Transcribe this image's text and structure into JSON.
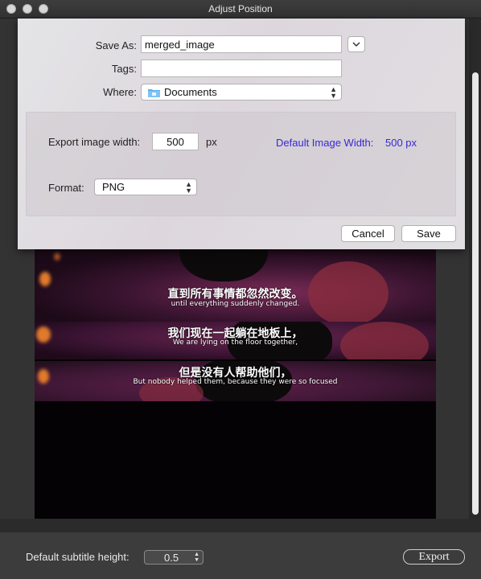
{
  "window": {
    "title": "Adjust Position"
  },
  "save_sheet": {
    "save_as_label": "Save As:",
    "save_as_value": "merged_image",
    "tags_label": "Tags:",
    "tags_value": "",
    "where_label": "Where:",
    "where_value": "Documents",
    "export_width_label": "Export image width:",
    "export_width_value": "500",
    "export_width_unit": "px",
    "default_width_label": "Default Image Width:",
    "default_width_value": "500 px",
    "format_label": "Format:",
    "format_value": "PNG",
    "cancel_label": "Cancel",
    "save_label": "Save"
  },
  "subtitles": [
    {
      "chinese": "直到所有事情都忽然改变。",
      "english": "until everything suddenly changed."
    },
    {
      "chinese": "我们现在一起躺在地板上，",
      "english": "We are lying on the floor together,"
    },
    {
      "chinese": "但是没有人帮助他们，",
      "english": "But nobody helped them, because they were so focused"
    }
  ],
  "bottom_bar": {
    "subtitle_height_label": "Default subtitle height:",
    "subtitle_height_value": "0.5",
    "export_label": "Export"
  },
  "colors": {
    "link_blue": "#3a27d6",
    "sheet_bg": "#e2e0e3",
    "window_bg": "#333333"
  },
  "icons": [
    "folder-icon",
    "chevron-updown-icon",
    "chevron-down-icon"
  ]
}
